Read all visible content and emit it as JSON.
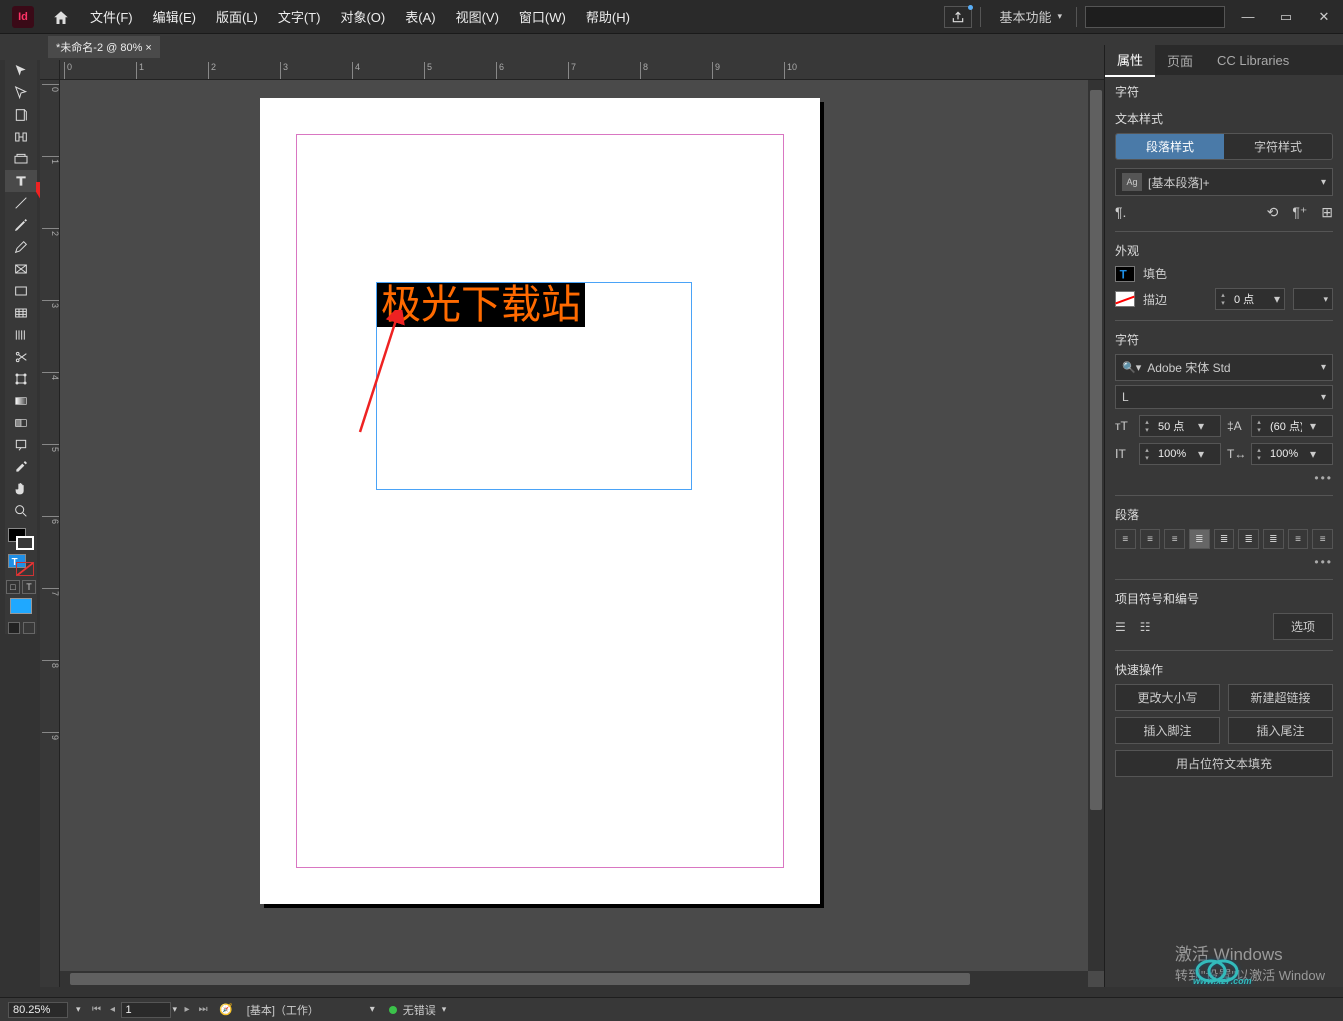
{
  "app": {
    "id_badge": "Id"
  },
  "menus": {
    "file": "文件(F)",
    "edit": "编辑(E)",
    "layout": "版面(L)",
    "text": "文字(T)",
    "object": "对象(O)",
    "table": "表(A)",
    "view": "视图(V)",
    "window": "窗口(W)",
    "help": "帮助(H)"
  },
  "workspace": {
    "label": "基本功能"
  },
  "tab": {
    "label": "*未命名-2 @ 80% ×"
  },
  "canvas": {
    "text": "极光下载站"
  },
  "right": {
    "tabs": {
      "properties": "属性",
      "pages": "页面",
      "cc": "CC Libraries"
    },
    "char_header": "字符",
    "text_styles": "文本样式",
    "para_style_tab": "段落样式",
    "char_style_tab": "字符样式",
    "style_dd": "[基本段落]+",
    "appearance": "外观",
    "fill": "填色",
    "stroke": "描边",
    "stroke_val": "0 点",
    "font": "Adobe 宋体 Std",
    "font_weight": "L",
    "size": "50 点",
    "leading": "(60 点)",
    "hscale": "100%",
    "vscale": "100%",
    "paragraph": "段落",
    "bullets": "项目符号和编号",
    "options": "选项",
    "quick": "快速操作",
    "change_case": "更改大小写",
    "new_link": "新建超链接",
    "insert_foot": "插入脚注",
    "insert_end": "插入尾注",
    "placeholder": "用占位符文本填充"
  },
  "status": {
    "zoom": "80.25%",
    "page": "1",
    "profile": "[基本]（工作）",
    "preflight": "无错误"
  },
  "activate": {
    "title": "激活 Windows",
    "sub": "转到\"设置\"以激活 Window"
  },
  "ruler_h": [
    "0",
    "1",
    "2",
    "3",
    "4",
    "5",
    "6",
    "7",
    "8",
    "9",
    "10"
  ],
  "ruler_v": [
    "0",
    "1",
    "2",
    "3",
    "4",
    "5",
    "6",
    "7",
    "8",
    "9"
  ]
}
